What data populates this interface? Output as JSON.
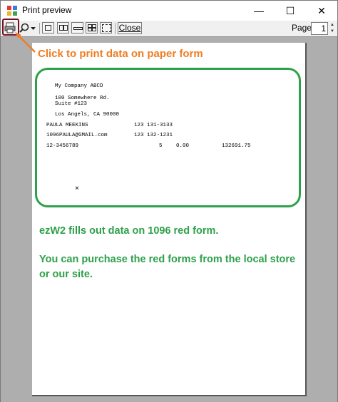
{
  "window": {
    "title": "Print preview",
    "minimize_glyph": "—",
    "maximize_glyph": "☐",
    "close_glyph": "✕"
  },
  "toolbar": {
    "close_label": "Close",
    "page_label": "Page",
    "page_value": "1",
    "icons": [
      "printer-icon",
      "zoom-icon",
      "dropdown-arrow-icon",
      "one-page-icon",
      "two-page-icon",
      "three-page-icon",
      "four-page-icon",
      "six-page-icon"
    ]
  },
  "callout": {
    "text": "Click to print data on paper form",
    "color": "#ef7d22",
    "highlight_color": "#7b0d22"
  },
  "form": {
    "company": "My Company ABCD",
    "address1": "100 Somewhere Rd.",
    "address2": "Suite #123",
    "city": "Los Angels, CA 90000",
    "contact_name": "PAULA MEEKINS",
    "phone1": "123 131-3133",
    "email": "1096PAULA@GMAIL.com",
    "phone2": "123 132-1231",
    "ein": "12-3456789",
    "forms_count": "5",
    "amount1": "0.00",
    "amount2": "132691.75",
    "checkbox_mark": "×",
    "border_color": "#2ea04a"
  },
  "notes": {
    "line1": "ezW2 fills out data on 1096 red form.",
    "line2": "You can purchase the red forms from the local store",
    "line3": "or our site.",
    "color": "#2ea04a"
  }
}
